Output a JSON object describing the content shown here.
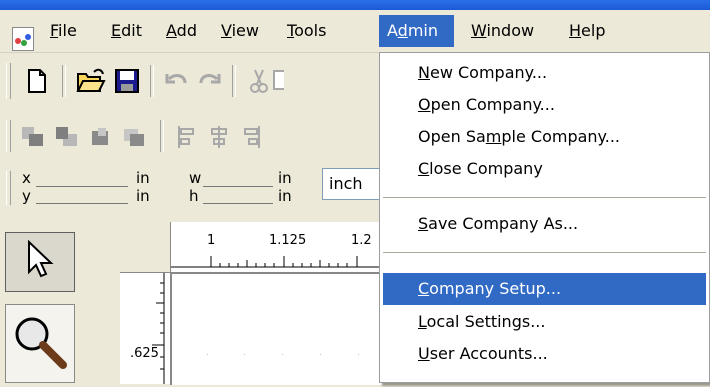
{
  "menubar": {
    "items": [
      {
        "label_pre": "",
        "label_key": "F",
        "label_post": "ile"
      },
      {
        "label_pre": "",
        "label_key": "E",
        "label_post": "dit"
      },
      {
        "label_pre": "",
        "label_key": "A",
        "label_post": "dd"
      },
      {
        "label_pre": "",
        "label_key": "V",
        "label_post": "iew"
      },
      {
        "label_pre": "",
        "label_key": "T",
        "label_post": "ools"
      },
      {
        "label_pre": "A",
        "label_key": "d",
        "label_post": "min"
      },
      {
        "label_pre": "",
        "label_key": "W",
        "label_post": "indow"
      },
      {
        "label_pre": "",
        "label_key": "H",
        "label_post": "elp"
      }
    ],
    "active_item": "Admin"
  },
  "position_toolbar": {
    "x_label": "x",
    "y_label": "y",
    "w_label": "w",
    "h_label": "h",
    "unit_x": "in",
    "unit_y": "in",
    "unit_w": "in",
    "unit_h": "in",
    "unit_select_value": "inch"
  },
  "ruler": {
    "h_ticks": [
      "1",
      "1.125",
      "1.2"
    ],
    "v_ticks": [
      ".625"
    ]
  },
  "admin_menu": {
    "items": [
      {
        "pre": "",
        "key": "N",
        "post": "ew Company..."
      },
      {
        "pre": "",
        "key": "O",
        "post": "pen Company..."
      },
      {
        "pre": "Open Sa",
        "key": "m",
        "post": "ple Company..."
      },
      {
        "pre": "",
        "key": "C",
        "post": "lose Company"
      },
      {
        "pre": "",
        "key": "S",
        "post": "ave Company As..."
      },
      {
        "pre": "",
        "key": "C",
        "post": "ompany Setup..."
      },
      {
        "pre": "",
        "key": "L",
        "post": "ocal Settings..."
      },
      {
        "pre": "",
        "key": "U",
        "post": "ser Accounts..."
      }
    ],
    "highlighted_item": "Company Setup..."
  },
  "colors": {
    "selection": "#316ac5",
    "titlebar": "#1c5ad8",
    "chrome": "#ece9d8"
  },
  "icons": [
    "app-icon",
    "new-document-icon",
    "open-folder-icon",
    "save-disk-icon",
    "undo-icon",
    "redo-icon",
    "cut-icon",
    "copy-icon",
    "bring-to-front-icon",
    "send-to-back-icon",
    "bring-forward-icon",
    "send-backward-icon",
    "align-left-icon",
    "align-center-icon",
    "align-right-icon",
    "pointer-arrow-icon",
    "zoom-magnifier-icon"
  ]
}
